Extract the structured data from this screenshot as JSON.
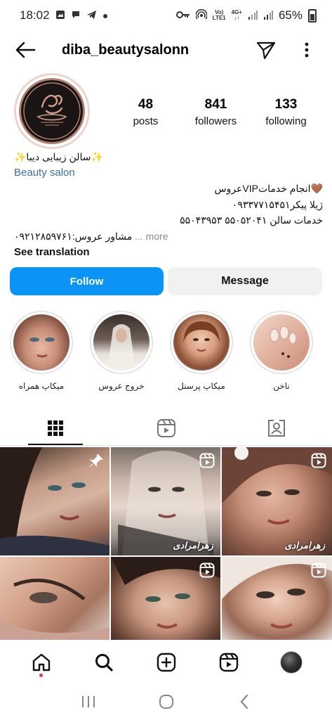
{
  "status_bar": {
    "time": "18:02",
    "net_top": "Vo)",
    "net_bottom": "LTE1",
    "net_type": "4G+",
    "battery": "65%"
  },
  "header": {
    "username": "diba_beautysalonn"
  },
  "profile": {
    "posts_count": "48",
    "posts_label": "posts",
    "followers_count": "841",
    "followers_label": "followers",
    "following_count": "133",
    "following_label": "following"
  },
  "bio": {
    "name_line": "✨سالن زیبایی دیبا✨",
    "category": "Beauty salon",
    "line1": "🤎انجام خدماتVIPعروس",
    "line2": "ژیلا پیکر۰۹۳۳۷۷۱۵۴۵۱",
    "line3": "خدمات سالن ۵۵۰۵۲۰۴۱ ۵۵۰۴۳۹۵۳",
    "line4": "مشاور عروس:۰۹۲۱۲۸۵۹۷۶۱",
    "more_label": "... more",
    "see_translation": "See translation"
  },
  "actions": {
    "follow_label": "Follow",
    "message_label": "Message"
  },
  "highlights": [
    {
      "label": "میکاپ همراه"
    },
    {
      "label": "خروج عروس"
    },
    {
      "label": "میکاپ پرسنل"
    },
    {
      "label": "ناخن"
    }
  ],
  "grid": {
    "caption_1": "زهرامرادی",
    "caption_2": "زهرامرادی"
  },
  "colors": {
    "follow_blue": "#0a95f6",
    "category_link": "#3c6e98",
    "nav_dot": "#e8383d"
  },
  "icons": {
    "back": "arrow-left-icon",
    "share": "paper-plane-icon",
    "menu": "kebab-icon",
    "grid_tab": "grid-icon",
    "reels_tab": "reels-icon",
    "tagged_tab": "tagged-icon",
    "home": "home-icon",
    "search": "search-icon",
    "create": "plus-square-icon",
    "reels_nav": "reels-icon"
  }
}
